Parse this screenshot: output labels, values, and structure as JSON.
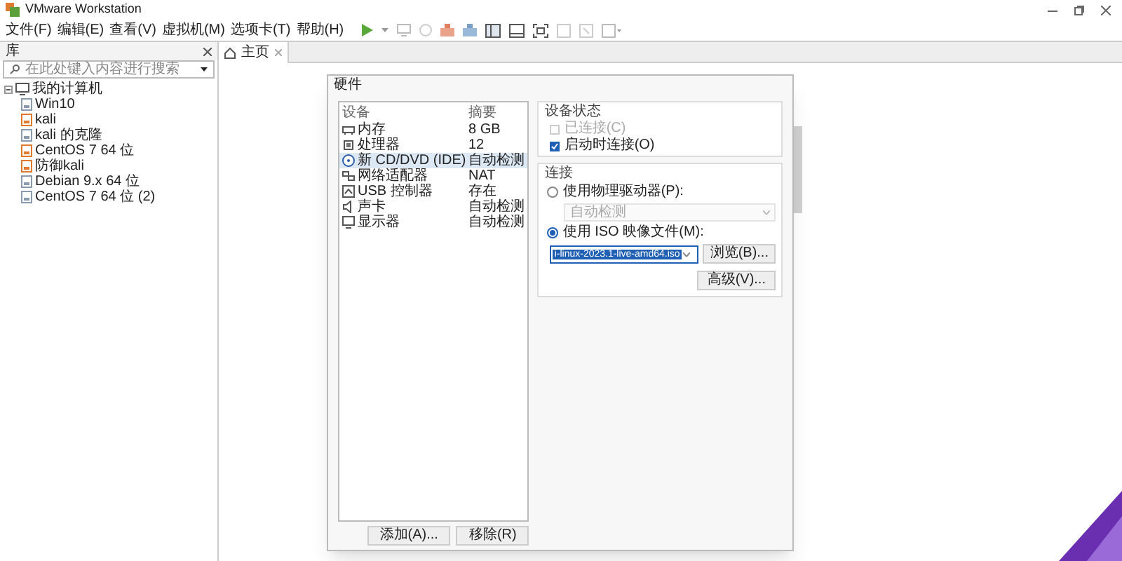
{
  "window": {
    "title": "VMware Workstation"
  },
  "menu": [
    "文件(F)",
    "编辑(E)",
    "查看(V)",
    "虚拟机(M)",
    "选项卡(T)",
    "帮助(H)"
  ],
  "library": {
    "title": "库",
    "search": {
      "placeholder": "在此处键入内容进行搜索"
    },
    "tree": [
      {
        "label": "我的计算机",
        "expanded": true,
        "children": [
          {
            "label": "Win10",
            "color": "#8a9bb0"
          },
          {
            "label": "kali",
            "color": "#e07a2e"
          },
          {
            "label": "kali 的克隆",
            "color": "#8a9bb0"
          },
          {
            "label": "CentOS 7 64 位",
            "color": "#e07a2e"
          },
          {
            "label": "防御kali",
            "color": "#e07a2e"
          },
          {
            "label": "Debian 9.x 64 位",
            "color": "#8a9bb0"
          },
          {
            "label": "CentOS 7 64 位 (2)",
            "color": "#8a9bb0"
          }
        ]
      }
    ]
  },
  "tabs": [
    {
      "label": "主页",
      "selected": true
    }
  ],
  "dialog": {
    "title": "硬件",
    "columns": [
      "设备",
      "摘要"
    ],
    "devices": [
      {
        "kind": "memory",
        "device": "内存",
        "summary": "8 GB",
        "selected": false
      },
      {
        "kind": "cpu",
        "device": "处理器",
        "summary": "12",
        "selected": false
      },
      {
        "kind": "disc",
        "device": "新 CD/DVD (IDE)",
        "summary": "自动检测",
        "selected": true
      },
      {
        "kind": "network",
        "device": "网络适配器",
        "summary": "NAT",
        "selected": false
      },
      {
        "kind": "usb",
        "device": "USB 控制器",
        "summary": "存在",
        "selected": false
      },
      {
        "kind": "sound",
        "device": "声卡",
        "summary": "自动检测",
        "selected": false
      },
      {
        "kind": "display",
        "device": "显示器",
        "summary": "自动检测",
        "selected": false
      }
    ],
    "list_buttons": [
      "添加(A)...",
      "移除(R)"
    ],
    "status": {
      "title": "设备状态",
      "options": [
        {
          "label": "已连接(C)",
          "checked": false,
          "disabled": true
        },
        {
          "label": "启动时连接(O)",
          "checked": true,
          "disabled": false
        }
      ]
    },
    "connection": {
      "title": "连接",
      "physical": {
        "label": "使用物理驱动器(P):",
        "selected": false,
        "value": "自动检测"
      },
      "iso": {
        "label": "使用 ISO 映像文件(M):",
        "selected": true,
        "value": "i-linux-2023.1-live-amd64.iso",
        "value_highlighted": true
      },
      "browse": "浏览(B)...",
      "advanced": "高级(V)..."
    }
  }
}
